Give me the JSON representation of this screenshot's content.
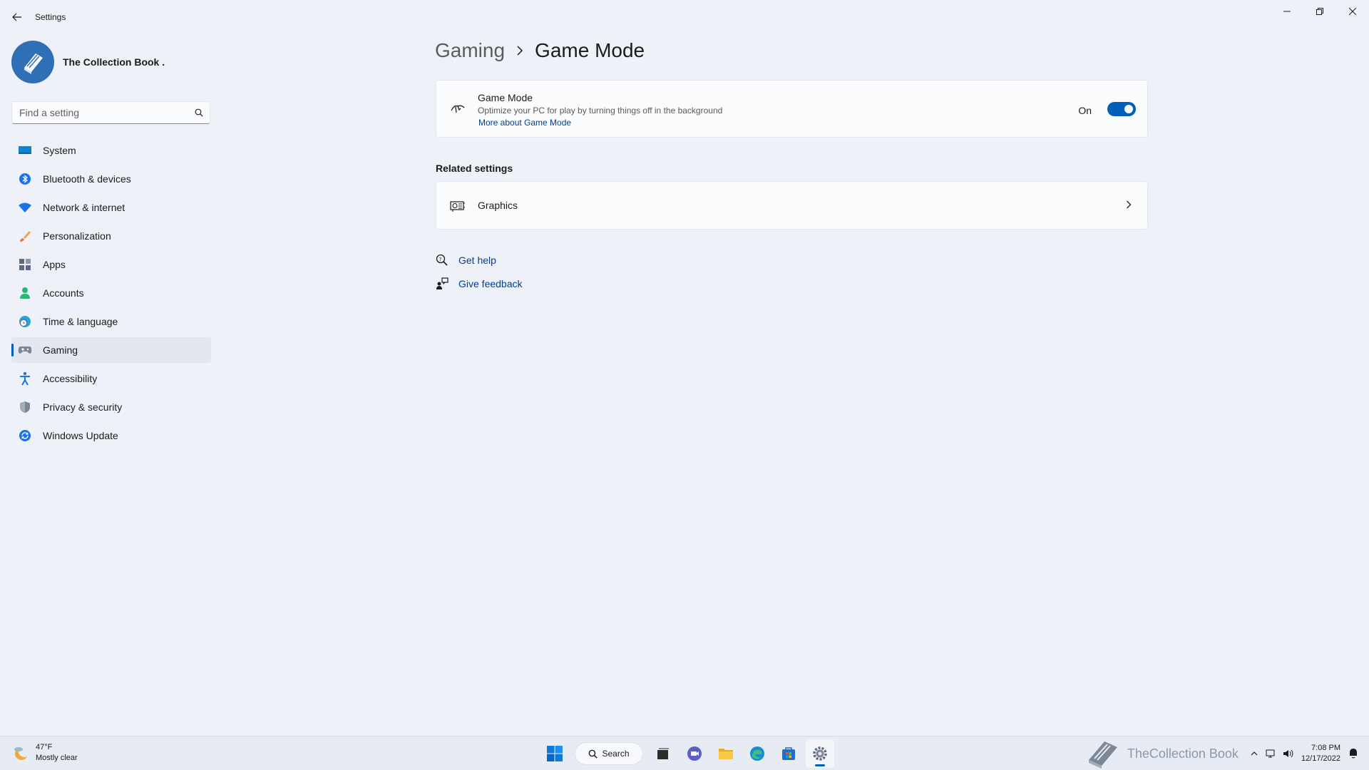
{
  "window": {
    "title": "Settings",
    "back_icon": "back-arrow-icon",
    "controls": [
      "minimize-icon",
      "restore-icon",
      "close-icon"
    ]
  },
  "profile": {
    "name": "The Collection Book ."
  },
  "search": {
    "placeholder": "Find a setting"
  },
  "sidebar": {
    "items": [
      {
        "label": "System",
        "icon": "monitor-icon",
        "color": "#0a84d6"
      },
      {
        "label": "Bluetooth & devices",
        "icon": "bluetooth-icon",
        "color": "#1a73e8"
      },
      {
        "label": "Network & internet",
        "icon": "wifi-icon",
        "color": "#1a73e8"
      },
      {
        "label": "Personalization",
        "icon": "brush-icon",
        "color": "#e07b39"
      },
      {
        "label": "Apps",
        "icon": "apps-icon",
        "color": "#5b6b82"
      },
      {
        "label": "Accounts",
        "icon": "person-icon",
        "color": "#2bb673"
      },
      {
        "label": "Time & language",
        "icon": "globe-clock-icon",
        "color": "#2a9fd8"
      },
      {
        "label": "Gaming",
        "icon": "gamepad-icon",
        "color": "#7a8694",
        "active": true
      },
      {
        "label": "Accessibility",
        "icon": "accessibility-icon",
        "color": "#1a73e8"
      },
      {
        "label": "Privacy & security",
        "icon": "shield-icon",
        "color": "#7a8694"
      },
      {
        "label": "Windows Update",
        "icon": "update-icon",
        "color": "#1a73e8"
      }
    ]
  },
  "breadcrumb": {
    "parent": "Gaming",
    "current": "Game Mode"
  },
  "game_mode_card": {
    "title": "Game Mode",
    "description": "Optimize your PC for play by turning things off in the background",
    "link": "More about Game Mode",
    "toggle_label": "On",
    "toggle_on": true
  },
  "related": {
    "heading": "Related settings",
    "graphics_label": "Graphics"
  },
  "help": {
    "get_help": "Get help",
    "give_feedback": "Give feedback"
  },
  "taskbar": {
    "weather_temp": "47°F",
    "weather_desc": "Mostly clear",
    "search_label": "Search",
    "apps": [
      "start-icon",
      "task-view-icon",
      "chat-icon",
      "file-explorer-icon",
      "edge-icon",
      "store-icon",
      "settings-icon"
    ],
    "active_app": "settings-icon",
    "watermark": "TheCollection Book",
    "time": "7:08 PM",
    "date": "12/17/2022"
  },
  "colors": {
    "accent": "#005fb8",
    "link": "#003e92",
    "background": "#eef2f8"
  }
}
